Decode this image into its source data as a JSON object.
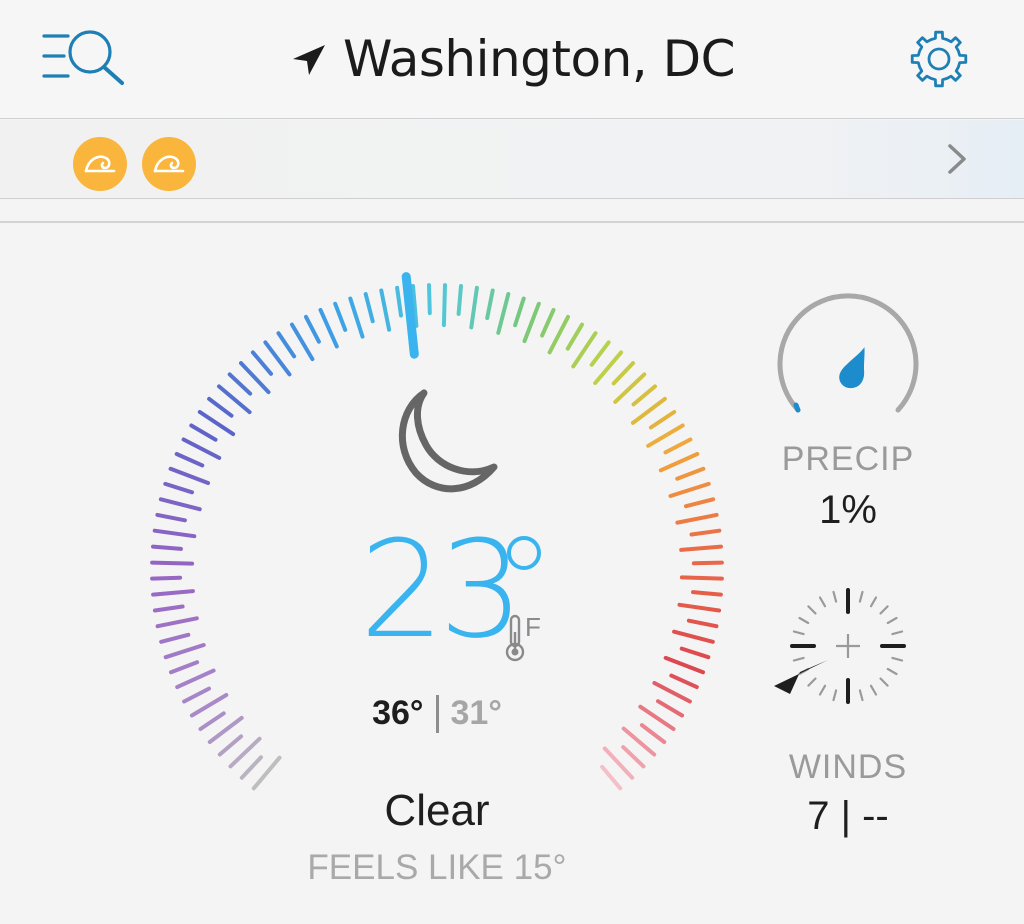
{
  "header": {
    "city": "Washington, DC",
    "search_icon": "search-list-icon",
    "location_icon": "location-arrow-icon",
    "settings_icon": "gear-icon"
  },
  "alerts": {
    "icons": [
      "wave-alert-icon",
      "wave-alert-icon"
    ],
    "alert_color": "#f9b53c",
    "chevron_icon": "chevron-right-icon"
  },
  "current": {
    "temperature": "23",
    "unit": "F",
    "condition_icon": "moon-icon",
    "high": "36°",
    "low": "31°",
    "condition": "Clear",
    "feels_like": "FEELS LIKE 15°",
    "accent_color": "#3ab4ee"
  },
  "precip": {
    "label": "PRECIP",
    "value": "1%",
    "level": 0.01,
    "icon": "raindrop-icon",
    "color": "#1d8ccc"
  },
  "winds": {
    "label": "WINDS",
    "value": "7 | --",
    "icon": "compass-icon",
    "direction": "southwest"
  }
}
